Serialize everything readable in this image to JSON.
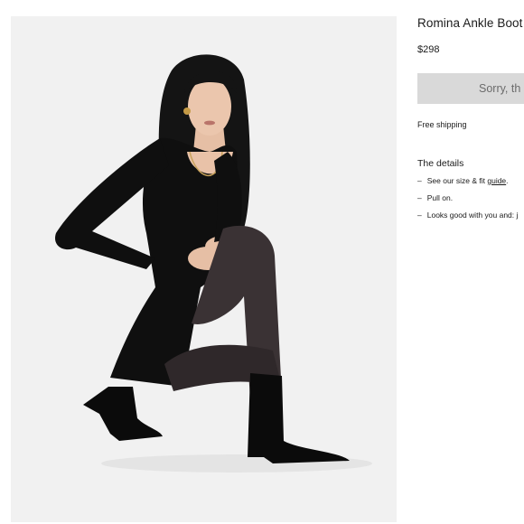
{
  "product": {
    "name": "Romina Ankle Boot",
    "price": "$298",
    "sold_out_label": "Sorry, th",
    "shipping_note": "Free shipping"
  },
  "details": {
    "title": "The details",
    "dash": "–",
    "size_fit_prefix": "See our size & fit ",
    "size_fit_link": "guide",
    "size_fit_suffix": ".",
    "pull_on": "Pull on.",
    "looks_good": "Looks good with you and: j"
  },
  "colors": {
    "photo_background": "#f1f1f1",
    "button_background": "#d9d9d9",
    "button_text": "#6b6b6b"
  }
}
